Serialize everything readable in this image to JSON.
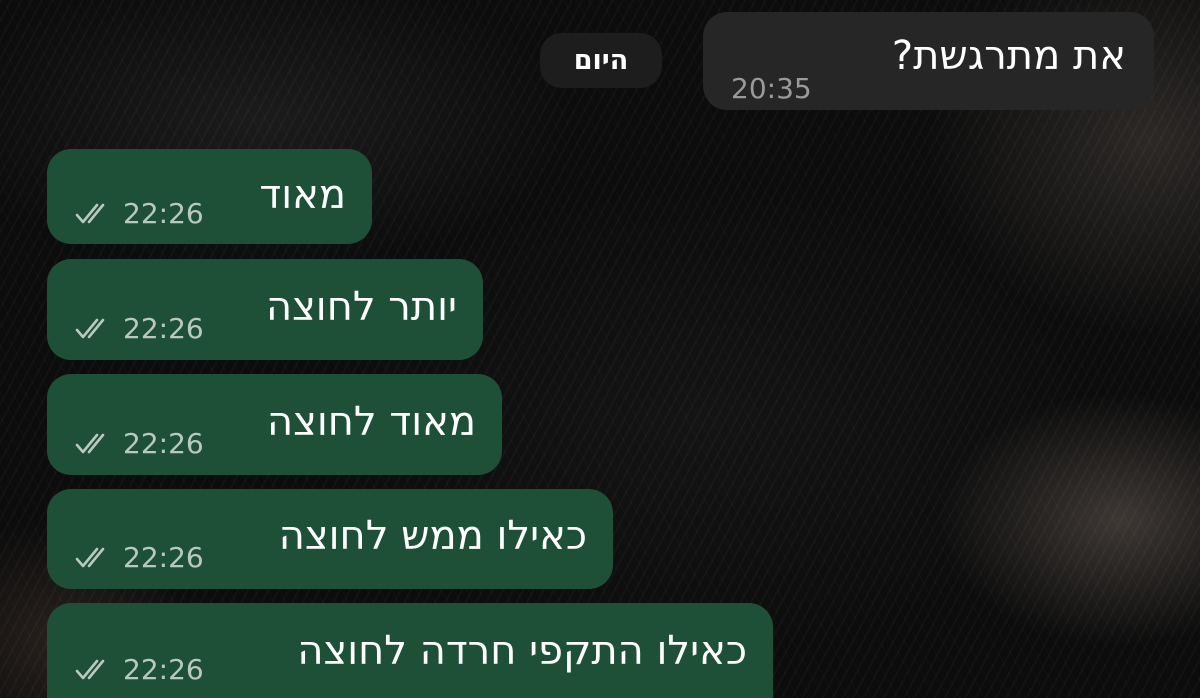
{
  "date_separator": "היום",
  "messages": [
    {
      "direction": "incoming",
      "text": "את מתרגשת?",
      "time": "20:35"
    },
    {
      "direction": "outgoing",
      "text": "מאוד",
      "time": "22:26",
      "status_icon": "double-check-icon"
    },
    {
      "direction": "outgoing",
      "text": "יותר לחוצה",
      "time": "22:26",
      "status_icon": "double-check-icon"
    },
    {
      "direction": "outgoing",
      "text": "מאוד לחוצה",
      "time": "22:26",
      "status_icon": "double-check-icon"
    },
    {
      "direction": "outgoing",
      "text": "כאילו ממש לחוצה",
      "time": "22:26",
      "status_icon": "double-check-icon"
    },
    {
      "direction": "outgoing",
      "text": "כאילו התקפי חרדה לחוצה",
      "time": "22:26",
      "status_icon": "double-check-icon"
    }
  ],
  "colors": {
    "outgoing_bubble": "#1e5038",
    "incoming_bubble": "#262626",
    "date_pill": "#1d1d1d",
    "meta_text_outgoing": "#b9c9bf",
    "meta_text_incoming": "#9a9a9a"
  }
}
